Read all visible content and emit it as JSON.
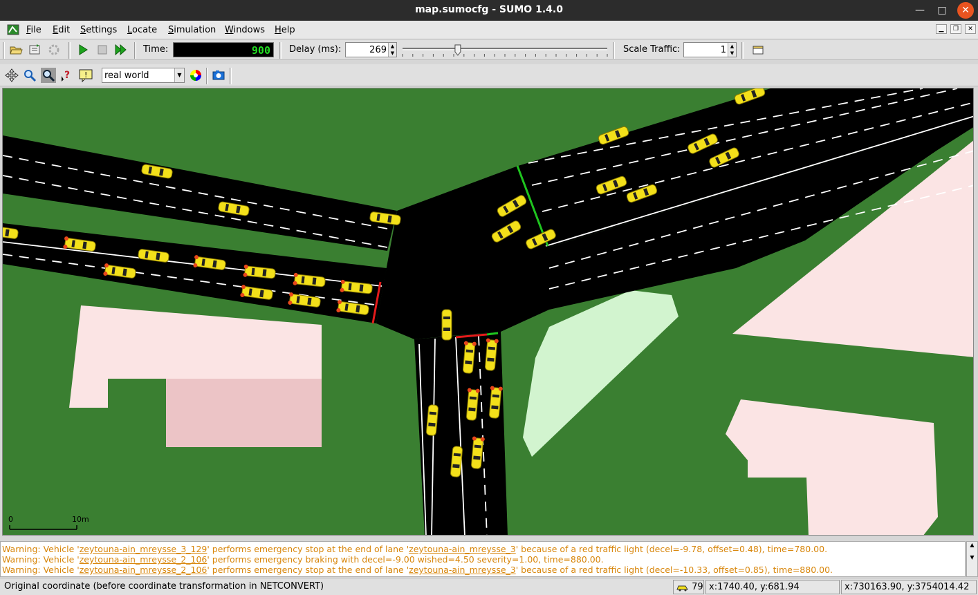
{
  "window": {
    "title": "map.sumocfg - SUMO 1.4.0",
    "minimize_glyph": "—",
    "maximize_glyph": "□",
    "close_glyph": "✕"
  },
  "menu": [
    {
      "label": "File",
      "mnemonic": "F",
      "rest": "ile"
    },
    {
      "label": "Edit",
      "mnemonic": "E",
      "rest": "dit"
    },
    {
      "label": "Settings",
      "mnemonic": "S",
      "rest": "ettings"
    },
    {
      "label": "Locate",
      "mnemonic": "L",
      "rest": "ocate"
    },
    {
      "label": "Simulation",
      "mnemonic": "S",
      "rest": "imulation"
    },
    {
      "label": "Windows",
      "mnemonic": "W",
      "rest": "indows"
    },
    {
      "label": "Help",
      "mnemonic": "H",
      "rest": "elp"
    }
  ],
  "toolbar": {
    "time_label": "Time:",
    "time_value": "900",
    "delay_label": "Delay (ms):",
    "delay_value": "269",
    "delay_fraction": 0.27,
    "scale_label": "Scale Traffic:",
    "scale_value": "1"
  },
  "view": {
    "scheme": "real world"
  },
  "map": {
    "scale_zero": "0",
    "scale_label": "10m"
  },
  "messages": [
    {
      "parts": [
        "Warning: Vehicle '",
        "zeytouna-ain_mreysse_3_129",
        "' performs emergency stop at the end of lane '",
        "zeytouna-ain_mreysse_3",
        "' because of a red traffic light (decel=-9.78, offset=0.48), time=780.00."
      ]
    },
    {
      "parts": [
        "Warning: Vehicle '",
        "zeytouna-ain_mreysse_2_106",
        "' performs emergency braking with decel=-9.00 wished=4.50 severity=1.00, time=880.00.",
        "",
        ""
      ]
    },
    {
      "parts": [
        "Warning: Vehicle '",
        "zeytouna-ain_mreysse_2_106",
        "' performs emergency stop at the end of lane '",
        "zeytouna-ain_mreysse_3",
        "' because of a red traffic light (decel=-10.33, offset=0.85), time=880.00."
      ]
    }
  ],
  "status": {
    "coord_info": "Original coordinate (before coordinate transformation in NETCONVERT)",
    "vehicle_count": "79",
    "net_coord": "x:1740.40, y:681.94",
    "geo_coord": "x:730163.90, y:3754014.42"
  },
  "colors": {
    "grass": "#3a7f31",
    "road": "#000000",
    "building": "#fbe4e4",
    "vehicle": "#f3e01a",
    "red_light": "#e41b1b",
    "green_light": "#1fc41f",
    "warning_text": "#d8860b"
  }
}
